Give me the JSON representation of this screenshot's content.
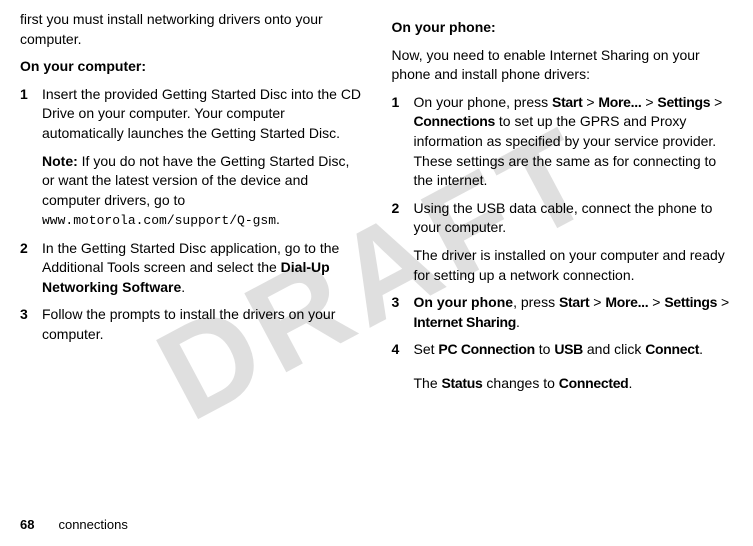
{
  "watermark": "DRAFT",
  "left": {
    "intro": "first you must install networking drivers onto your computer.",
    "heading": "On your computer:",
    "step1_num": "1",
    "step1_text": "Insert the provided Getting Started Disc into the CD Drive on your computer. Your computer automatically launches the Getting Started Disc.",
    "note_label": "Note:",
    "note_text": " If you do not have the Getting Started Disc, or want the latest version of the device and computer drivers, go to ",
    "note_url": "www.motorola.com/support/Q-gsm",
    "note_period": ".",
    "step2_num": "2",
    "step2_a": "In the Getting Started Disc application, go to the Additional Tools screen and select the ",
    "step2_b": "Dial-Up Networking Software",
    "step2_c": ".",
    "step3_num": "3",
    "step3_text": "Follow the prompts to install the drivers on your computer."
  },
  "right": {
    "heading": "On your phone:",
    "intro": "Now, you need to enable Internet Sharing on your phone and install phone drivers:",
    "step1_num": "1",
    "step1_a": "On your phone, press ",
    "step1_start": "Start",
    "gt": " > ",
    "step1_more": "More...",
    "step1_settings": "Settings",
    "step1_connections": "Connections",
    "step1_b": " to set up the GPRS and Proxy information as specified by your service provider. These settings are the same as for connecting to the internet.",
    "step2_num": "2",
    "step2_a": "Using the USB data cable, connect the phone to your computer.",
    "step2_b": "The driver is installed on your computer and ready for setting up a network connection.",
    "step3_num": "3",
    "step3_bold": "On your phone",
    "step3_a": ", press ",
    "step3_internet_sharing": "Internet Sharing",
    "step3_period": ".",
    "step4_num": "4",
    "step4_a": "Set ",
    "step4_pc": "PC Connection",
    "step4_b": " to ",
    "step4_usb": "USB",
    "step4_c": " and click ",
    "step4_connect": "Connect",
    "step4_d": ".",
    "status_a": "The ",
    "status_status": "Status",
    "status_b": " changes to ",
    "status_connected": "Connected",
    "status_c": "."
  },
  "footer": {
    "page": "68",
    "section": "connections"
  }
}
